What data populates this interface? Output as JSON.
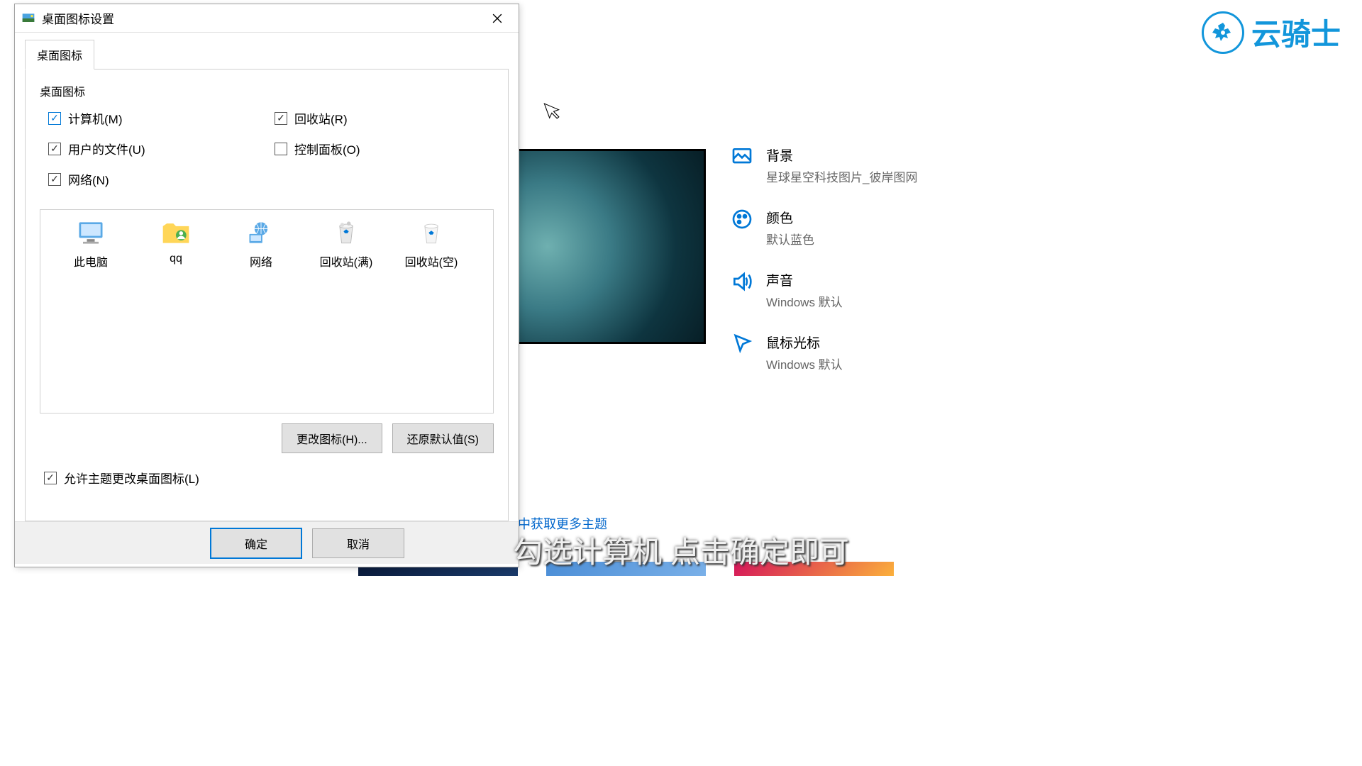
{
  "dialog": {
    "title": "桌面图标设置",
    "tab": "桌面图标",
    "fieldset": "桌面图标",
    "checkboxes": {
      "computer": {
        "label": "计算机(M)",
        "checked": true
      },
      "recycle": {
        "label": "回收站(R)",
        "checked": true
      },
      "userfiles": {
        "label": "用户的文件(U)",
        "checked": true
      },
      "control": {
        "label": "控制面板(O)",
        "checked": false
      },
      "network": {
        "label": "网络(N)",
        "checked": true
      }
    },
    "icons": [
      {
        "name": "此电脑"
      },
      {
        "name": "qq"
      },
      {
        "name": "网络"
      },
      {
        "name": "回收站(满)"
      },
      {
        "name": "回收站(空)"
      }
    ],
    "change_icon_btn": "更改图标(H)...",
    "restore_btn": "还原默认值(S)",
    "allow_theme": {
      "label": "允许主题更改桌面图标(L)",
      "checked": true
    },
    "ok_btn": "确定",
    "cancel_btn": "取消"
  },
  "settings": {
    "background": {
      "title": "背景",
      "sub": "星球星空科技图片_彼岸图网"
    },
    "color": {
      "title": "颜色",
      "sub": "默认蓝色"
    },
    "sound": {
      "title": "声音",
      "sub": "Windows 默认"
    },
    "cursor": {
      "title": "鼠标光标",
      "sub": "Windows 默认"
    },
    "more_themes": "中获取更多主题"
  },
  "watermark": "云骑士",
  "subtitle": "勾选计算机 点击确定即可"
}
